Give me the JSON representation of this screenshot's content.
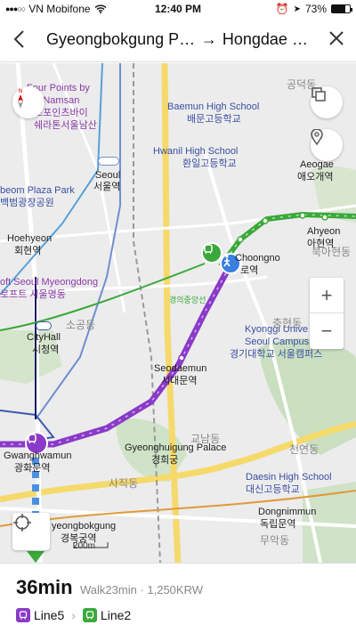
{
  "status": {
    "carrier": "VN Mobifone",
    "time": "12:40 PM",
    "battery": "73%",
    "battery_level": 0.73
  },
  "nav": {
    "origin": "Gyeongbokgung Pa...",
    "arrow": "→",
    "destination": "Hongdae St..."
  },
  "map": {
    "labels": {
      "namsan1": "Four Points by",
      "namsan2": "ton Namsan",
      "namsan3": "포포인츠바이",
      "namsan4": "쉐라톤서울남산",
      "baemun1": "Baemun High School",
      "baemun2": "배문고등학교",
      "hwanil1": "Hwanil High School",
      "hwanil2": "환일고등학교",
      "gongdeok": "공덕동",
      "seoul1": "Seoul",
      "seoul2": "서울역",
      "aeogae1": "Aeogae",
      "aeogae2": "애오개역",
      "plaza1": "beom Plaza Park",
      "plaza2": "백범광장공원",
      "hoehyeon1": "Hoehyeon",
      "hoehyeon2": "회현역",
      "ahyeon1": "Ahyeon",
      "ahyeon2": "아현역",
      "ahyeondong": "북아현동",
      "chungjeongno1": "Choongno",
      "chungjeongno2": "로역",
      "myeongdong1": "oft Seoul Myeongdong",
      "myeongdong2": "로프트 서울명동",
      "gyeongui": "경의중앙선",
      "sogong": "소공동",
      "cityhall1": "CityHall",
      "cityhall2": "시청역",
      "kyonggi1": "Kyonggi Unive",
      "kyonggi2": "Seoul Campus",
      "kyonggi3": "경기대학교 서울캠퍼스",
      "chunghyeon": "충현동",
      "seodaemun1": "Seodaemun",
      "seodaemun2": "서대문역",
      "palace1": "Gyeonghuigung Palace",
      "palace2": "경희궁",
      "gwanghwamun1": "Gwanghwamun",
      "gwanghwamun2": "광화문역",
      "gyobuk": "교남동",
      "cheonyeon": "천연동",
      "sajik": "사직동",
      "daesin1": "Daesin High School",
      "daesin2": "대신고등학교",
      "dongnimmun1": "Dongnimmun",
      "dongnimmun2": "독립문역",
      "muak": "무악동",
      "gyeongbok1": "yeongbokgung",
      "gyeongbok2": "경복궁역"
    },
    "scale": "200m",
    "zoom_in": "+",
    "zoom_out": "−"
  },
  "route": {
    "total_time": "36min",
    "detail": "Walk23min · 1,250KRW",
    "line1": "Line5",
    "line2": "Line2",
    "line1_color": "#8a3ac8",
    "line2_color": "#3aa83a"
  }
}
